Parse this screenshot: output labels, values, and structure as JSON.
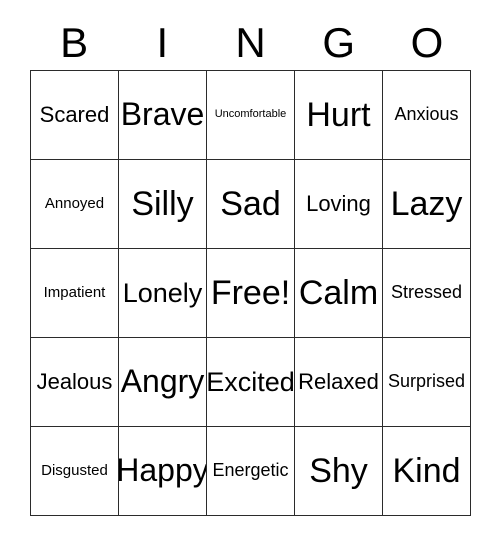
{
  "card": {
    "type": "bingo-card",
    "columns": 5,
    "rows": 5,
    "background_color": "#ffffff",
    "border_color": "#2b2b2b",
    "text_color": "#000000"
  },
  "header": {
    "letters": [
      {
        "label": "B"
      },
      {
        "label": "I"
      },
      {
        "label": "N"
      },
      {
        "label": "G"
      },
      {
        "label": "O"
      }
    ]
  },
  "grid": {
    "rows": [
      {
        "cells": [
          {
            "label": "Scared",
            "size": "sz-m"
          },
          {
            "label": "Brave",
            "size": "sz-xl"
          },
          {
            "label": "Uncomfortable",
            "size": "sz-xxs"
          },
          {
            "label": "Hurt",
            "size": "sz-xxl"
          },
          {
            "label": "Anxious",
            "size": "sz-s"
          }
        ]
      },
      {
        "cells": [
          {
            "label": "Annoyed",
            "size": "sz-xs"
          },
          {
            "label": "Silly",
            "size": "sz-xxl"
          },
          {
            "label": "Sad",
            "size": "sz-xxl"
          },
          {
            "label": "Loving",
            "size": "sz-m"
          },
          {
            "label": "Lazy",
            "size": "sz-xxl"
          }
        ]
      },
      {
        "cells": [
          {
            "label": "Impatient",
            "size": "sz-xs"
          },
          {
            "label": "Lonely",
            "size": "sz-l"
          },
          {
            "label": "Free!",
            "size": "sz-xxl",
            "free_space": true
          },
          {
            "label": "Calm",
            "size": "sz-xxl"
          },
          {
            "label": "Stressed",
            "size": "sz-s"
          }
        ]
      },
      {
        "cells": [
          {
            "label": "Jealous",
            "size": "sz-m"
          },
          {
            "label": "Angry",
            "size": "sz-xl"
          },
          {
            "label": "Excited",
            "size": "sz-l"
          },
          {
            "label": "Relaxed",
            "size": "sz-m"
          },
          {
            "label": "Surprised",
            "size": "sz-s"
          }
        ]
      },
      {
        "cells": [
          {
            "label": "Disgusted",
            "size": "sz-xs"
          },
          {
            "label": "Happy",
            "size": "sz-xl"
          },
          {
            "label": "Energetic",
            "size": "sz-s"
          },
          {
            "label": "Shy",
            "size": "sz-xxl"
          },
          {
            "label": "Kind",
            "size": "sz-xxl"
          }
        ]
      }
    ]
  }
}
